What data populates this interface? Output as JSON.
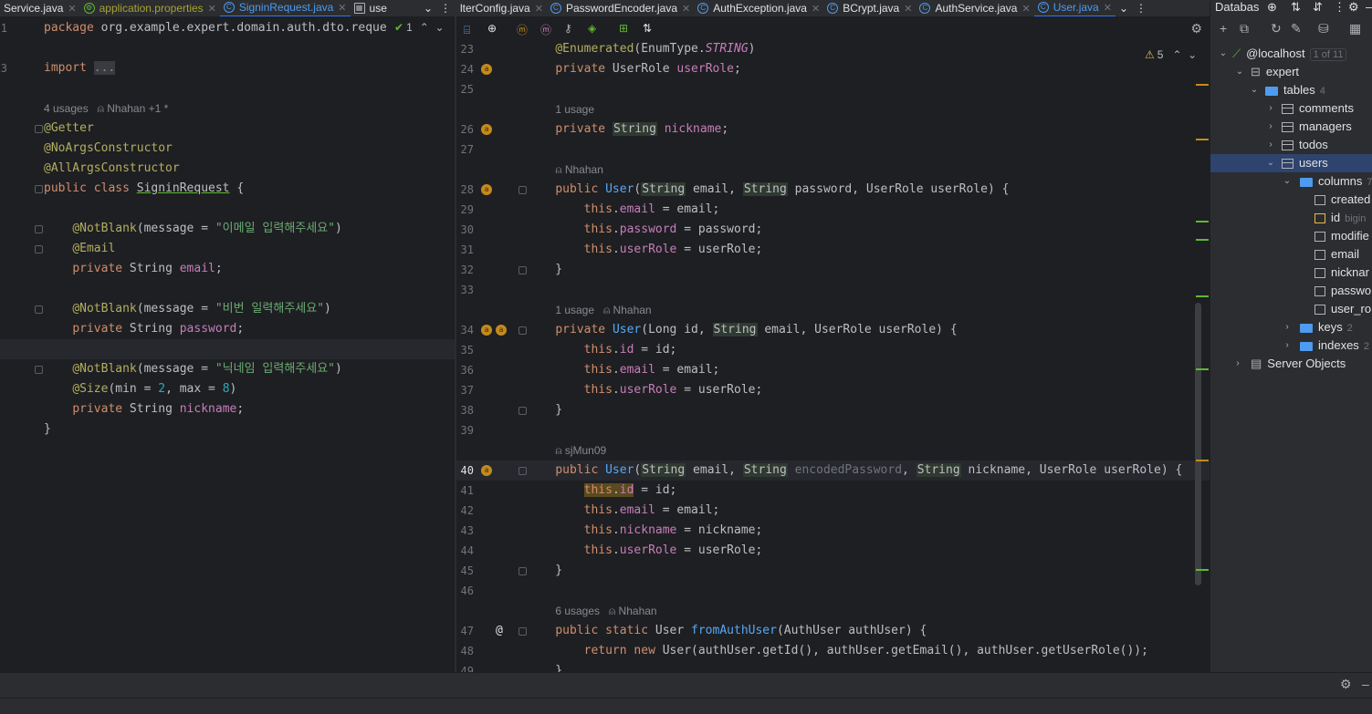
{
  "left_tabs": [
    {
      "label": "Service.java",
      "active": false,
      "mod": false
    },
    {
      "label": "application.properties",
      "active": false,
      "mod": true
    },
    {
      "label": "SigninRequest.java",
      "active": true,
      "mod": false
    },
    {
      "label": "use",
      "active": false,
      "mod": false
    }
  ],
  "right_tabs": [
    {
      "label": "lterConfig.java",
      "active": false
    },
    {
      "label": "PasswordEncoder.java",
      "active": false
    },
    {
      "label": "AuthException.java",
      "active": false
    },
    {
      "label": "BCrypt.java",
      "active": false
    },
    {
      "label": "AuthService.java",
      "active": false
    },
    {
      "label": "User.java",
      "active": true
    }
  ],
  "left_editor": {
    "inspections": "1",
    "lines": [
      {
        "n": "1",
        "html": "<span class='kw'>package</span> org.example.expert.domain.auth.dto.reque"
      },
      {
        "n": "",
        "html": ""
      },
      {
        "n": "3",
        "html": "<span class='kw'>import</span> <span style='background:#393b40;color:#868a91'>...</span>"
      },
      {
        "n": "",
        "html": ""
      },
      {
        "n": "",
        "html": "<span class='hint'>4 usages &nbsp; ⍝ Nhahan +1 *</span>"
      },
      {
        "n": "",
        "html": "<span class='an'>@Getter</span>"
      },
      {
        "n": "",
        "html": "<span class='an'>@NoArgsConstructor</span>"
      },
      {
        "n": "",
        "html": "<span class='an'>@AllArgsConstructor</span>"
      },
      {
        "n": "",
        "html": "<span class='kw'>public class</span> <u style='text-decoration-color:#5fb832'>SigninRequest</u> {"
      },
      {
        "n": "",
        "html": ""
      },
      {
        "n": "",
        "html": "    <span class='an'>@NotBlank</span>(message = <span class='str'>\"이메일 입력해주세요\"</span>)"
      },
      {
        "n": "",
        "html": "    <span class='an'>@Email</span>"
      },
      {
        "n": "",
        "html": "    <span class='kw'>private</span> String <span class='fld'>email</span>;"
      },
      {
        "n": "",
        "html": ""
      },
      {
        "n": "",
        "html": "    <span class='an'>@NotBlank</span>(message = <span class='str'>\"비번 일력해주세요\"</span>)"
      },
      {
        "n": "",
        "html": "    <span class='kw'>private</span> String <span class='fld'>password</span>;"
      },
      {
        "n": "",
        "html": ""
      },
      {
        "n": "",
        "html": "    <span class='an'>@NotBlank</span>(message = <span class='str'>\"닉네임 입력해주세요\"</span>)"
      },
      {
        "n": "",
        "html": "    <span class='an'>@Size</span>(min = <span class='num'>2</span>, max = <span class='num'>8</span>)"
      },
      {
        "n": "",
        "html": "    <span class='kw'>private</span> String <span class='fld'>nickname</span>;"
      },
      {
        "n": "",
        "html": "}"
      },
      {
        "n": "",
        "html": ""
      }
    ]
  },
  "right_editor": {
    "warnings": "5",
    "lines": [
      {
        "n": "23",
        "html": "    <span class='an'>@Enumerated</span>(EnumType.<span class='ital'>STRING</span>)"
      },
      {
        "n": "24",
        "html": "    <span class='kw'>private</span> UserRole <span class='fld'>userRole</span>;"
      },
      {
        "n": "25",
        "html": ""
      },
      {
        "n": "",
        "html": "    <span class='hint'>1 usage</span>"
      },
      {
        "n": "26",
        "html": "    <span class='kw'>private</span> <span class='tybox'>String</span> <span class='fld'>nickname</span>;"
      },
      {
        "n": "27",
        "html": ""
      },
      {
        "n": "",
        "html": "    <span class='hint'>⍝ Nhahan</span>"
      },
      {
        "n": "28",
        "html": "    <span class='kw'>public</span> <span class='fn'>User</span>(<span class='tybox'>String</span> email, <span class='tybox'>String</span> password, UserRole userRole) {"
      },
      {
        "n": "29",
        "html": "        <span class='kw'>this</span>.<span class='fld'>email</span> = email;"
      },
      {
        "n": "30",
        "html": "        <span class='kw'>this</span>.<span class='fld'>password</span> = password;"
      },
      {
        "n": "31",
        "html": "        <span class='kw'>this</span>.<span class='fld'>userRole</span> = userRole;"
      },
      {
        "n": "32",
        "html": "    }"
      },
      {
        "n": "33",
        "html": ""
      },
      {
        "n": "",
        "html": "    <span class='hint'>1 usage &nbsp; ⍝ Nhahan</span>"
      },
      {
        "n": "34",
        "html": "    <span class='kw'>private</span> <span class='fn'>User</span>(Long id, <span class='tybox'>String</span> email, UserRole userRole) {"
      },
      {
        "n": "35",
        "html": "        <span class='kw'>this</span>.<span class='fld'>id</span> = id;"
      },
      {
        "n": "36",
        "html": "        <span class='kw'>this</span>.<span class='fld'>email</span> = email;"
      },
      {
        "n": "37",
        "html": "        <span class='kw'>this</span>.<span class='fld'>userRole</span> = userRole;"
      },
      {
        "n": "38",
        "html": "    }"
      },
      {
        "n": "39",
        "html": ""
      },
      {
        "n": "",
        "html": "    <span class='hint'>⍝ sjMun09</span>"
      },
      {
        "n": "40",
        "html": "    <span class='kw'>public</span> <span class='fn'>User</span>(<span class='tybox'>String</span> email, <span class='tybox'>String</span> <span class='param'>encodedPassword</span>, <span class='tybox'>String</span> nickname, UserRole userRole) {"
      },
      {
        "n": "41",
        "html": "        <span style='background:#5a4a1e'><span class='kw'>this</span>.<span class='fld'>id</span></span> = id;"
      },
      {
        "n": "42",
        "html": "        <span class='kw'>this</span>.<span class='fld'>email</span> = email;"
      },
      {
        "n": "43",
        "html": "        <span class='kw'>this</span>.<span class='fld'>nickname</span> = nickname;"
      },
      {
        "n": "44",
        "html": "        <span class='kw'>this</span>.<span class='fld'>userRole</span> = userRole;"
      },
      {
        "n": "45",
        "html": "    }"
      },
      {
        "n": "46",
        "html": ""
      },
      {
        "n": "",
        "html": "    <span class='hint'>6 usages &nbsp; ⍝ Nhahan</span>"
      },
      {
        "n": "47",
        "html": "    <span class='kw'>public static</span> User <span class='fn'>fromAuthUser</span>(AuthUser authUser) {"
      },
      {
        "n": "48",
        "html": "        <span class='kw'>return new</span> User(authUser.getId(), authUser.getEmail(), authUser.getUserRole());"
      },
      {
        "n": "49",
        "html": "    }"
      }
    ]
  },
  "db": {
    "title": "Databas",
    "host": "@localhost",
    "host_badge": "1 of 11",
    "schema": "expert",
    "tables_label": "tables",
    "tables_count": "4",
    "tables": [
      "comments",
      "managers",
      "todos",
      "users"
    ],
    "columns_label": "columns",
    "columns_count": "7",
    "columns": [
      "created",
      "id",
      "modifie",
      "email",
      "nicknar",
      "passwo",
      "user_ro"
    ],
    "id_type": "bigin",
    "keys_label": "keys",
    "keys_count": "2",
    "indexes_label": "indexes",
    "indexes_count": "2",
    "server_objects": "Server Objects"
  }
}
